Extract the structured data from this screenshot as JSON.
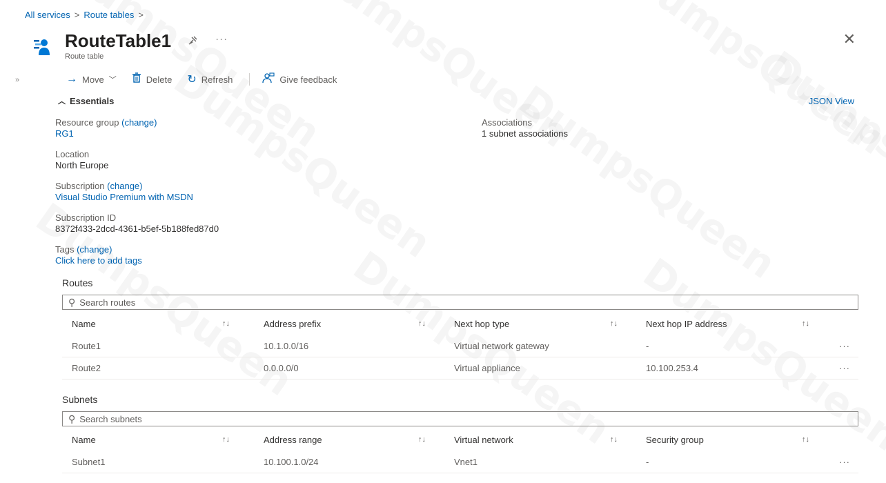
{
  "breadcrumb": {
    "items": [
      "All services",
      "Route tables"
    ],
    "separator": ">"
  },
  "header": {
    "title": "RouteTable1",
    "subtitle": "Route table",
    "pin_icon": "pin-icon",
    "more_label": "···",
    "close_label": "✕"
  },
  "sidebar": {
    "collapse_label": "»"
  },
  "toolbar": {
    "move_label": "Move",
    "delete_label": "Delete",
    "refresh_label": "Refresh",
    "feedback_label": "Give feedback"
  },
  "essentials": {
    "toggle_label": "Essentials",
    "json_view_label": "JSON View",
    "resource_group": {
      "label": "Resource group",
      "change": "(change)",
      "value": "RG1"
    },
    "location": {
      "label": "Location",
      "value": "North Europe"
    },
    "subscription": {
      "label": "Subscription",
      "change": "(change)",
      "value": "Visual Studio Premium with MSDN"
    },
    "subscription_id": {
      "label": "Subscription ID",
      "value": "8372f433-2dcd-4361-b5ef-5b188fed87d0"
    },
    "tags": {
      "label": "Tags",
      "change": "(change)",
      "value": "Click here to add tags"
    },
    "associations": {
      "label": "Associations",
      "value": "1 subnet associations"
    }
  },
  "routes": {
    "title": "Routes",
    "search_placeholder": "Search routes",
    "columns": [
      "Name",
      "Address prefix",
      "Next hop type",
      "Next hop IP address"
    ],
    "rows": [
      [
        "Route1",
        "10.1.0.0/16",
        "Virtual network gateway",
        "-"
      ],
      [
        "Route2",
        "0.0.0.0/0",
        "Virtual appliance",
        "10.100.253.4"
      ]
    ]
  },
  "subnets": {
    "title": "Subnets",
    "search_placeholder": "Search subnets",
    "columns": [
      "Name",
      "Address range",
      "Virtual network",
      "Security group"
    ],
    "rows": [
      [
        "Subnet1",
        "10.100.1.0/24",
        "Vnet1",
        "-"
      ]
    ]
  },
  "watermark": "DumpsQueen",
  "colors": {
    "link": "#0063b1",
    "text": "#323130",
    "muted": "#605e5c"
  }
}
